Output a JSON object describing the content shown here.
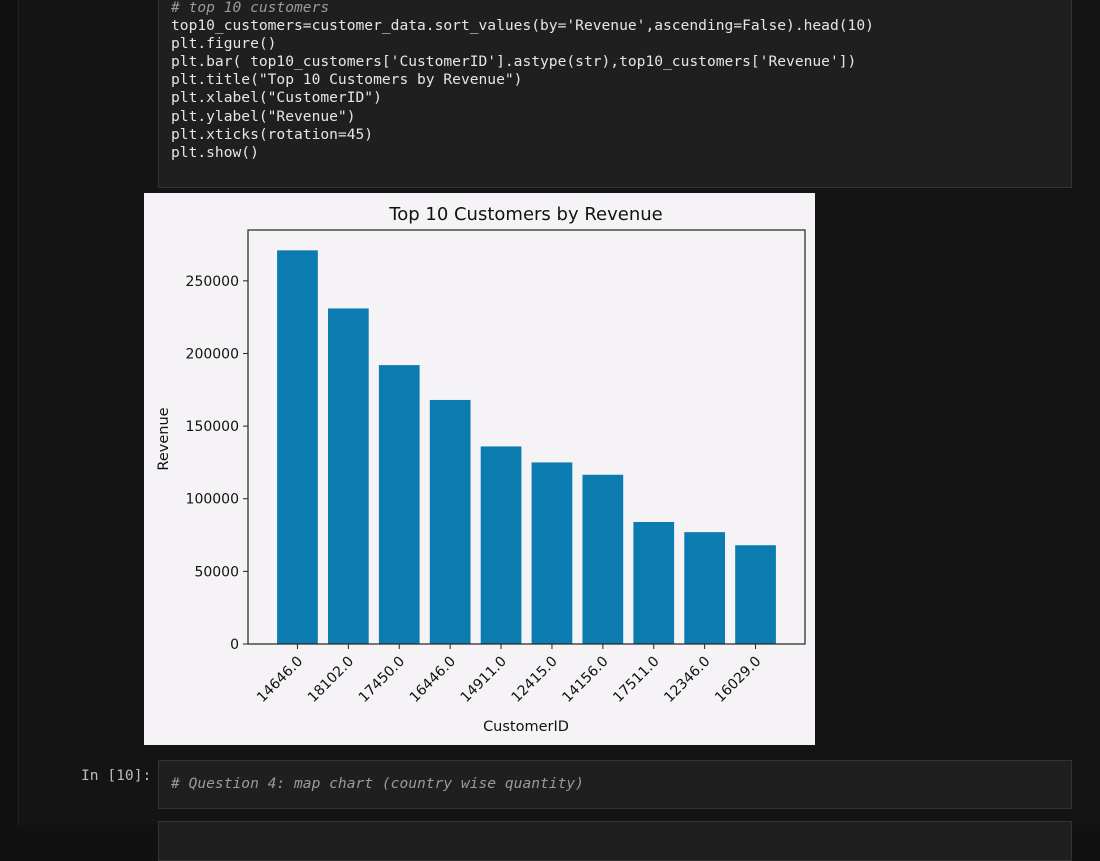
{
  "code_cell": {
    "lines": [
      "# top 10 customers",
      "top10_customers=customer_data.sort_values(by='Revenue',ascending=False).head(10)",
      "plt.figure()",
      "plt.bar( top10_customers['CustomerID'].astype(str),top10_customers['Revenue'])",
      "plt.title(\"Top 10 Customers by Revenue\")",
      "plt.xlabel(\"CustomerID\")",
      "plt.ylabel(\"Revenue\")",
      "plt.xticks(rotation=45)",
      "plt.show()"
    ]
  },
  "next_cell": {
    "prompt": "In [10]:",
    "comment": "# Question 4: map chart (country wise quantity)"
  },
  "colors": {
    "bar": "#0c7bb0",
    "figure_bg": "#f5f3f6",
    "cell_bg": "#1f1f1f"
  },
  "chart_data": {
    "type": "bar",
    "title": "Top 10 Customers by Revenue",
    "xlabel": "CustomerID",
    "ylabel": "Revenue",
    "categories": [
      "14646.0",
      "18102.0",
      "17450.0",
      "16446.0",
      "14911.0",
      "12415.0",
      "14156.0",
      "17511.0",
      "12346.0",
      "16029.0"
    ],
    "values": [
      271000,
      231000,
      192000,
      168000,
      136000,
      125000,
      116500,
      84000,
      77000,
      68000
    ],
    "yticks": [
      "0",
      "50000",
      "100000",
      "150000",
      "200000",
      "250000"
    ],
    "ylim": [
      0,
      285000
    ],
    "grid": false,
    "xtick_rotation": 45
  }
}
